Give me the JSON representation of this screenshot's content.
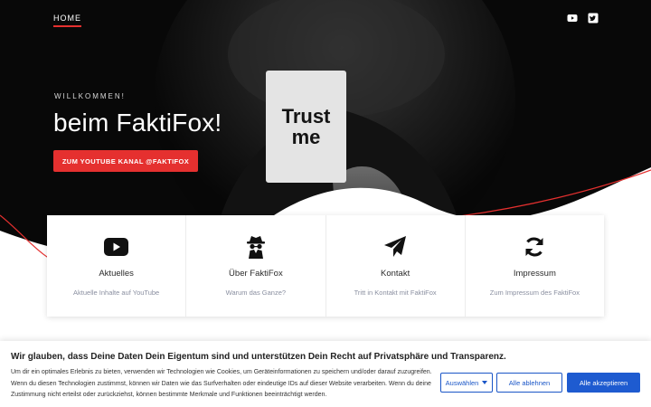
{
  "nav": {
    "home_label": "HOME"
  },
  "social": {
    "youtube_icon": "youtube-icon",
    "twitter_icon": "twitter-icon"
  },
  "hero": {
    "welcome": "WILLKOMMEN!",
    "headline": "beim FaktiFox!",
    "cta_label": "ZUM YOUTUBE KANAL @FAKTIFOX",
    "sign_line1": "Trust",
    "sign_line2": "me"
  },
  "features": [
    {
      "title": "Aktuelles",
      "subtitle": "Aktuelle Inhalte auf YouTube",
      "icon": "youtube-icon"
    },
    {
      "title": "Über FaktiFox",
      "subtitle": "Warum das Ganze?",
      "icon": "spy-icon"
    },
    {
      "title": "Kontakt",
      "subtitle": "Tritt in Kontakt mit FaktiFox",
      "icon": "paper-plane-icon"
    },
    {
      "title": "Impressum",
      "subtitle": "Zum Impressum des FaktiFox",
      "icon": "refresh-icon"
    }
  ],
  "cookie": {
    "title": "Wir glauben, dass Deine Daten Dein Eigentum sind und unterstützen Dein Recht auf Privatsphäre und Transparenz.",
    "text": "Um dir ein optimales Erlebnis zu bieten, verwenden wir Technologien wie Cookies, um Geräteinformationen zu speichern und/oder darauf zuzugreifen. Wenn du diesen Technologien zustimmst, können wir Daten wie das Surfverhalten oder eindeutige IDs auf dieser Website verarbeiten. Wenn du deine Zustimmung nicht erteilst oder zurückziehst, können bestimmte Merkmale und Funktionen beeinträchtigt werden.",
    "select_label": "Auswählen",
    "decline_label": "Alle ablehnen",
    "accept_label": "Alle akzeptieren"
  },
  "colors": {
    "accent": "#e5302f",
    "button_blue": "#1e5bd0",
    "hero_bg": "#0b0b0b"
  }
}
